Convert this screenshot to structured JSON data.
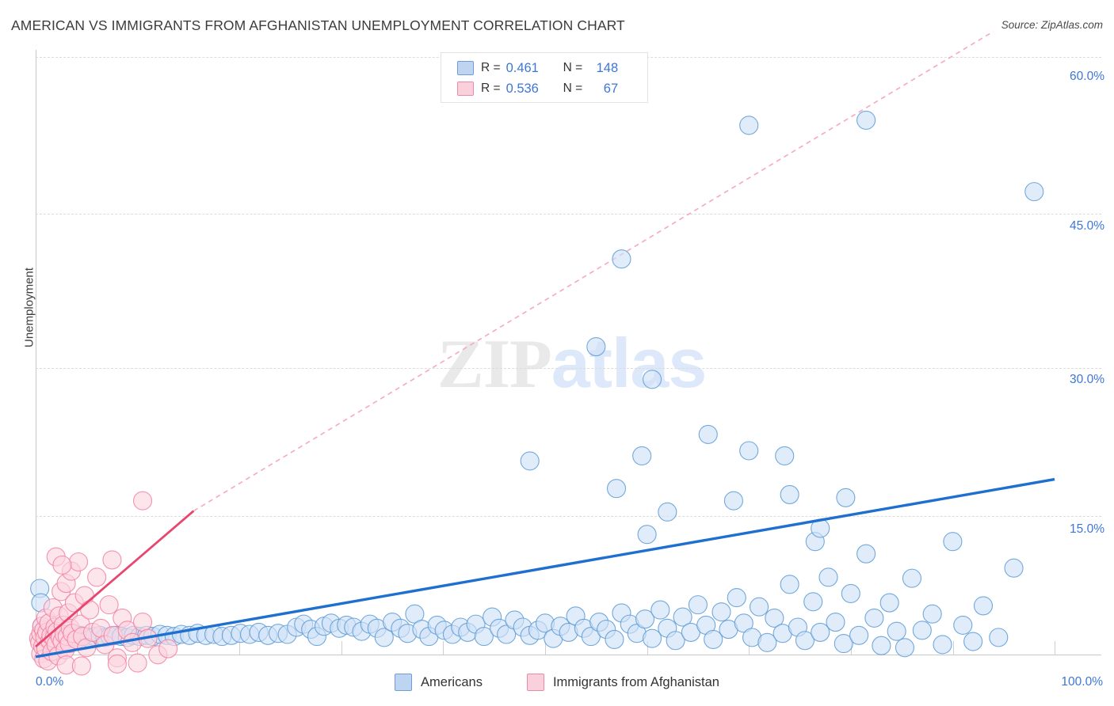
{
  "header": {
    "title": "AMERICAN VS IMMIGRANTS FROM AFGHANISTAN UNEMPLOYMENT CORRELATION CHART",
    "source": "Source: ZipAtlas.com"
  },
  "watermark": {
    "part1": "ZIP",
    "part2": "atlas"
  },
  "stats": {
    "rows": [
      {
        "r_label": "R =",
        "r_value": "0.461",
        "n_label": "N =",
        "n_value": "148",
        "color": "#bed5f2"
      },
      {
        "r_label": "R =",
        "r_value": "0.536",
        "n_label": "N =",
        "n_value": "67",
        "color": "#fbd0dd"
      }
    ]
  },
  "legend": {
    "items": [
      {
        "label": "Americans",
        "color": "#bed5f2",
        "border": "#6f9ddb"
      },
      {
        "label": "Immigrants from Afghanistan",
        "color": "#fbd0dd",
        "border": "#ef88a8"
      }
    ]
  },
  "chart_data": {
    "type": "scatter",
    "title": "AMERICAN VS IMMIGRANTS FROM AFGHANISTAN UNEMPLOYMENT CORRELATION CHART",
    "xlabel": "",
    "ylabel": "Unemployment",
    "xlim": [
      0,
      100
    ],
    "ylim": [
      0,
      63.5
    ],
    "xticks": [
      0,
      10,
      20,
      30,
      40,
      50,
      60,
      70,
      80,
      90,
      100
    ],
    "xtick_labels": [
      "0.0%",
      "100.0%"
    ],
    "yticks": [
      15,
      30,
      45,
      60
    ],
    "ytick_labels": [
      "15.0%",
      "30.0%",
      "45.0%",
      "60.0%"
    ],
    "grid": true,
    "legend_position": "bottom-center",
    "series": [
      {
        "name": "Americans",
        "color": "#cfe0f7",
        "border": "#5b9bd5",
        "r": 0.461,
        "n": 148,
        "trendline": {
          "style": "solid",
          "color": "#1f6fd0",
          "x0": 0.0,
          "y0": 1.2,
          "x1": 100.0,
          "y1": 18.6
        },
        "points": [
          [
            0.4,
            7.9
          ],
          [
            0.5,
            6.5
          ],
          [
            0.6,
            4.2
          ],
          [
            0.8,
            3.5
          ],
          [
            1.0,
            3.2
          ],
          [
            1.2,
            3.0
          ],
          [
            1.4,
            3.1
          ],
          [
            1.6,
            3.4
          ],
          [
            1.9,
            3.0
          ],
          [
            2.2,
            3.2
          ],
          [
            2.5,
            3.3
          ],
          [
            2.9,
            3.1
          ],
          [
            3.2,
            3.0
          ],
          [
            3.6,
            3.2
          ],
          [
            4.0,
            3.1
          ],
          [
            4.4,
            3.3
          ],
          [
            4.9,
            3.2
          ],
          [
            5.3,
            3.0
          ],
          [
            5.8,
            3.2
          ],
          [
            6.3,
            3.3
          ],
          [
            6.8,
            3.1
          ],
          [
            7.3,
            3.2
          ],
          [
            7.9,
            3.3
          ],
          [
            8.4,
            3.2
          ],
          [
            9.0,
            3.1
          ],
          [
            9.6,
            3.3
          ],
          [
            10.2,
            3.2
          ],
          [
            10.9,
            3.3
          ],
          [
            11.5,
            3.2
          ],
          [
            12.2,
            3.4
          ],
          [
            12.9,
            3.3
          ],
          [
            13.6,
            3.2
          ],
          [
            14.3,
            3.4
          ],
          [
            15.1,
            3.3
          ],
          [
            15.9,
            3.5
          ],
          [
            16.7,
            3.3
          ],
          [
            17.5,
            3.4
          ],
          [
            18.3,
            3.2
          ],
          [
            19.2,
            3.3
          ],
          [
            20.1,
            3.5
          ],
          [
            21.0,
            3.4
          ],
          [
            21.9,
            3.6
          ],
          [
            22.8,
            3.3
          ],
          [
            23.8,
            3.5
          ],
          [
            24.7,
            3.4
          ],
          [
            25.6,
            4.1
          ],
          [
            26.3,
            4.4
          ],
          [
            27.0,
            3.9
          ],
          [
            27.6,
            3.2
          ],
          [
            28.3,
            4.2
          ],
          [
            29.0,
            4.5
          ],
          [
            29.8,
            4.0
          ],
          [
            30.5,
            4.3
          ],
          [
            31.2,
            4.1
          ],
          [
            32.0,
            3.7
          ],
          [
            32.8,
            4.4
          ],
          [
            33.5,
            4.0
          ],
          [
            34.2,
            3.1
          ],
          [
            35.0,
            4.6
          ],
          [
            35.8,
            4.0
          ],
          [
            36.5,
            3.5
          ],
          [
            37.2,
            5.4
          ],
          [
            37.9,
            3.9
          ],
          [
            38.6,
            3.2
          ],
          [
            39.4,
            4.3
          ],
          [
            40.1,
            3.8
          ],
          [
            40.9,
            3.4
          ],
          [
            41.7,
            4.1
          ],
          [
            42.4,
            3.6
          ],
          [
            43.2,
            4.4
          ],
          [
            44.0,
            3.2
          ],
          [
            44.8,
            5.1
          ],
          [
            45.5,
            4.0
          ],
          [
            46.2,
            3.4
          ],
          [
            47.0,
            4.8
          ],
          [
            47.8,
            4.1
          ],
          [
            48.5,
            3.3
          ],
          [
            49.3,
            3.8
          ],
          [
            50.0,
            4.5
          ],
          [
            50.8,
            3.0
          ],
          [
            51.5,
            4.2
          ],
          [
            52.3,
            3.6
          ],
          [
            53.0,
            5.2
          ],
          [
            53.8,
            4.0
          ],
          [
            54.5,
            3.2
          ],
          [
            55.3,
            4.6
          ],
          [
            56.0,
            3.9
          ],
          [
            56.8,
            2.9
          ],
          [
            57.5,
            5.5
          ],
          [
            58.3,
            4.4
          ],
          [
            59.0,
            3.5
          ],
          [
            59.8,
            4.9
          ],
          [
            60.5,
            3.0
          ],
          [
            61.3,
            5.8
          ],
          [
            62.0,
            4.0
          ],
          [
            62.8,
            2.8
          ],
          [
            63.5,
            5.1
          ],
          [
            64.3,
            3.6
          ],
          [
            65.0,
            6.3
          ],
          [
            65.8,
            4.3
          ],
          [
            66.5,
            2.9
          ],
          [
            67.3,
            5.6
          ],
          [
            68.0,
            3.9
          ],
          [
            68.8,
            7.0
          ],
          [
            69.5,
            4.5
          ],
          [
            70.3,
            3.1
          ],
          [
            71.0,
            6.1
          ],
          [
            71.8,
            2.6
          ],
          [
            72.5,
            5.0
          ],
          [
            73.3,
            3.5
          ],
          [
            74.0,
            8.3
          ],
          [
            74.8,
            4.1
          ],
          [
            75.5,
            2.8
          ],
          [
            76.3,
            6.6
          ],
          [
            77.0,
            3.6
          ],
          [
            77.8,
            9.0
          ],
          [
            78.5,
            4.6
          ],
          [
            79.3,
            2.5
          ],
          [
            80.0,
            7.4
          ],
          [
            80.8,
            3.3
          ],
          [
            81.5,
            11.3
          ],
          [
            82.3,
            5.0
          ],
          [
            83.0,
            2.3
          ],
          [
            83.8,
            6.5
          ],
          [
            84.5,
            3.7
          ],
          [
            85.3,
            2.1
          ],
          [
            86.0,
            8.9
          ],
          [
            87.0,
            3.8
          ],
          [
            88.0,
            5.4
          ],
          [
            89.0,
            2.4
          ],
          [
            90.0,
            12.5
          ],
          [
            91.0,
            4.3
          ],
          [
            92.0,
            2.7
          ],
          [
            93.0,
            6.2
          ],
          [
            94.5,
            3.1
          ],
          [
            96.0,
            9.9
          ],
          [
            48.5,
            20.4
          ],
          [
            55.0,
            31.6
          ],
          [
            57.5,
            40.2
          ],
          [
            60.5,
            28.4
          ],
          [
            59.5,
            20.9
          ],
          [
            57.0,
            17.7
          ],
          [
            62.0,
            15.4
          ],
          [
            66.0,
            23.0
          ],
          [
            68.5,
            16.5
          ],
          [
            70.0,
            21.4
          ],
          [
            73.5,
            20.9
          ],
          [
            74.0,
            17.1
          ],
          [
            76.5,
            12.5
          ],
          [
            77.0,
            13.8
          ],
          [
            79.5,
            16.8
          ],
          [
            70.0,
            53.3
          ],
          [
            81.5,
            53.8
          ],
          [
            98.0,
            46.8
          ],
          [
            60.0,
            13.2
          ]
        ]
      },
      {
        "name": "Immigrants from Afghanistan",
        "color": "#fbd5e0",
        "border": "#f2809f",
        "r": 0.536,
        "n": 67,
        "trendline": {
          "style": "solid",
          "color": "#e8456f",
          "x0": 0.0,
          "y0": 2.2,
          "x1": 15.5,
          "y1": 15.5
        },
        "trendline_extension": {
          "style": "dashed",
          "color": "#f6a8c0",
          "x0": 15.5,
          "y0": 15.5,
          "x1": 94.0,
          "y1": 62.5
        },
        "points": [
          [
            0.3,
            3.0
          ],
          [
            0.4,
            2.6
          ],
          [
            0.5,
            3.5
          ],
          [
            0.5,
            1.5
          ],
          [
            0.6,
            4.2
          ],
          [
            0.7,
            2.2
          ],
          [
            0.8,
            3.8
          ],
          [
            0.8,
            1.0
          ],
          [
            0.9,
            3.1
          ],
          [
            1.0,
            5.0
          ],
          [
            1.0,
            2.0
          ],
          [
            1.1,
            3.6
          ],
          [
            1.2,
            0.8
          ],
          [
            1.3,
            4.5
          ],
          [
            1.4,
            2.8
          ],
          [
            1.5,
            3.3
          ],
          [
            1.6,
            1.7
          ],
          [
            1.7,
            6.0
          ],
          [
            1.8,
            3.0
          ],
          [
            1.9,
            4.1
          ],
          [
            2.0,
            2.4
          ],
          [
            2.1,
            3.7
          ],
          [
            2.2,
            1.3
          ],
          [
            2.3,
            5.2
          ],
          [
            2.4,
            3.1
          ],
          [
            2.5,
            7.6
          ],
          [
            2.6,
            2.7
          ],
          [
            2.7,
            4.3
          ],
          [
            2.8,
            3.4
          ],
          [
            2.9,
            1.9
          ],
          [
            3.0,
            8.4
          ],
          [
            3.1,
            3.2
          ],
          [
            3.2,
            5.5
          ],
          [
            3.3,
            2.5
          ],
          [
            3.4,
            4.0
          ],
          [
            3.5,
            9.6
          ],
          [
            3.6,
            3.5
          ],
          [
            3.8,
            6.5
          ],
          [
            4.0,
            2.9
          ],
          [
            4.2,
            10.5
          ],
          [
            4.4,
            4.4
          ],
          [
            4.6,
            3.2
          ],
          [
            4.8,
            7.2
          ],
          [
            5.0,
            2.1
          ],
          [
            5.3,
            5.8
          ],
          [
            5.6,
            3.6
          ],
          [
            6.0,
            9.0
          ],
          [
            6.4,
            4.0
          ],
          [
            6.8,
            2.4
          ],
          [
            7.2,
            6.3
          ],
          [
            7.6,
            3.3
          ],
          [
            8.0,
            1.1
          ],
          [
            8.5,
            5.0
          ],
          [
            9.0,
            3.8
          ],
          [
            9.5,
            2.6
          ],
          [
            10.0,
            0.6
          ],
          [
            10.5,
            4.6
          ],
          [
            11.0,
            3.0
          ],
          [
            12.0,
            1.4
          ],
          [
            13.0,
            2.0
          ],
          [
            2.0,
            11.0
          ],
          [
            2.6,
            10.2
          ],
          [
            3.0,
            0.4
          ],
          [
            7.5,
            10.7
          ],
          [
            10.5,
            16.5
          ],
          [
            4.5,
            0.3
          ],
          [
            8.0,
            0.5
          ]
        ]
      }
    ]
  },
  "axis": {
    "x_left_label": "0.0%",
    "x_right_label": "100.0%",
    "y_labels": [
      "60.0%",
      "45.0%",
      "30.0%",
      "15.0%"
    ]
  }
}
